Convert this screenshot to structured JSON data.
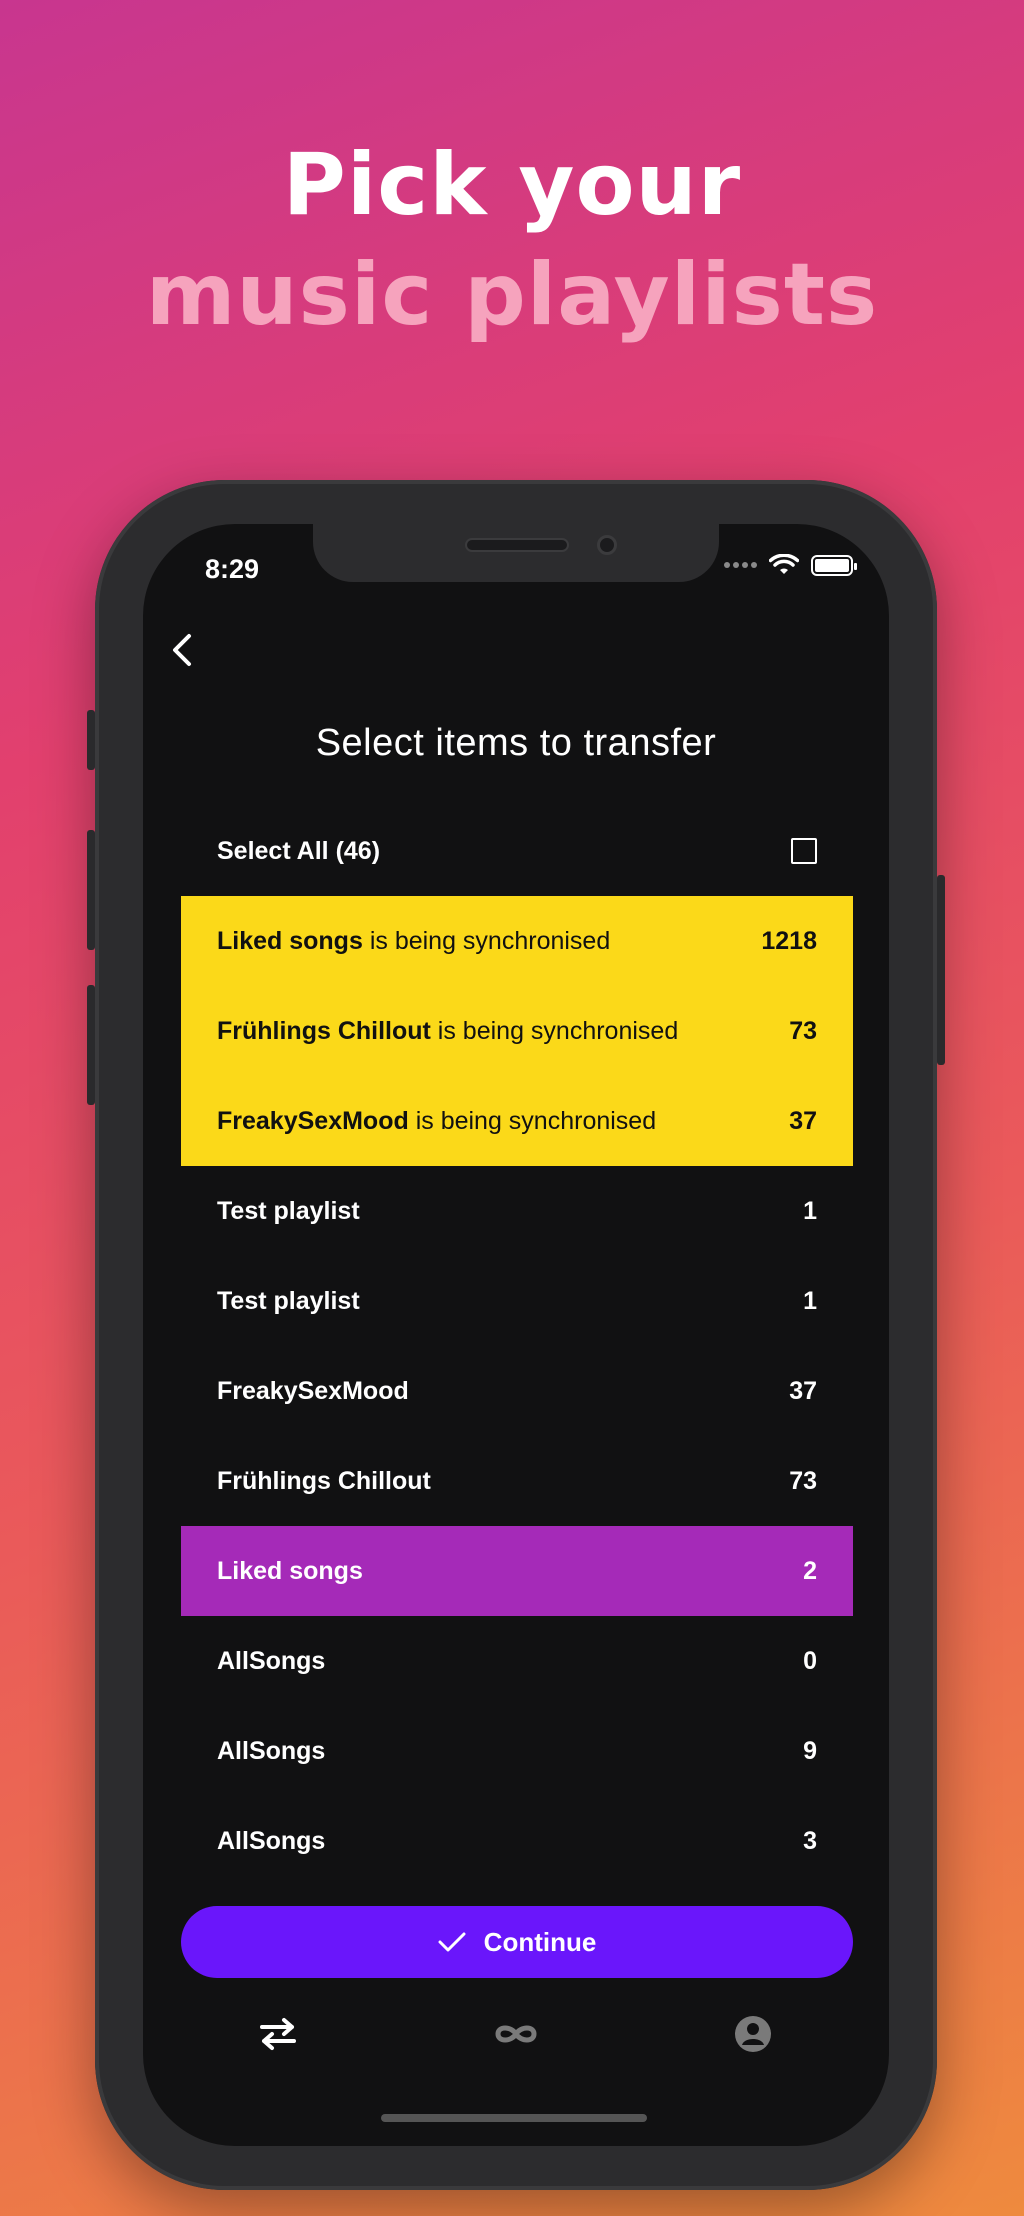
{
  "headline": {
    "line1": "Pick your",
    "line2": "music playlists"
  },
  "status": {
    "time": "8:29"
  },
  "screen": {
    "title": "Select items to transfer"
  },
  "select_all": {
    "label": "Select All (46)"
  },
  "sync_rows": [
    {
      "name": "Liked songs",
      "suffix": " is being synchronised",
      "count": "1218"
    },
    {
      "name": "Frühlings Chillout",
      "suffix": " is being synchronised",
      "count": "73"
    },
    {
      "name": "FreakySexMood",
      "suffix": " is being synchronised",
      "count": "37"
    }
  ],
  "rows": [
    {
      "name": "Test playlist",
      "count": "1"
    },
    {
      "name": "Test playlist",
      "count": "1"
    },
    {
      "name": "FreakySexMood",
      "count": "37"
    },
    {
      "name": "Frühlings Chillout",
      "count": "73"
    },
    {
      "name": "Liked songs",
      "count": "2",
      "selected": true
    },
    {
      "name": "AllSongs",
      "count": "0"
    },
    {
      "name": "AllSongs",
      "count": "9"
    },
    {
      "name": "AllSongs",
      "count": "3"
    }
  ],
  "continue_button": {
    "label": "Continue"
  },
  "tabs": [
    {
      "icon": "transfer-icon",
      "active": true
    },
    {
      "icon": "infinity-icon",
      "active": false
    },
    {
      "icon": "profile-icon",
      "active": false
    }
  ],
  "colors": {
    "sync": "#fbd919",
    "selected": "#a52ab8",
    "accent": "#6a16fb"
  }
}
